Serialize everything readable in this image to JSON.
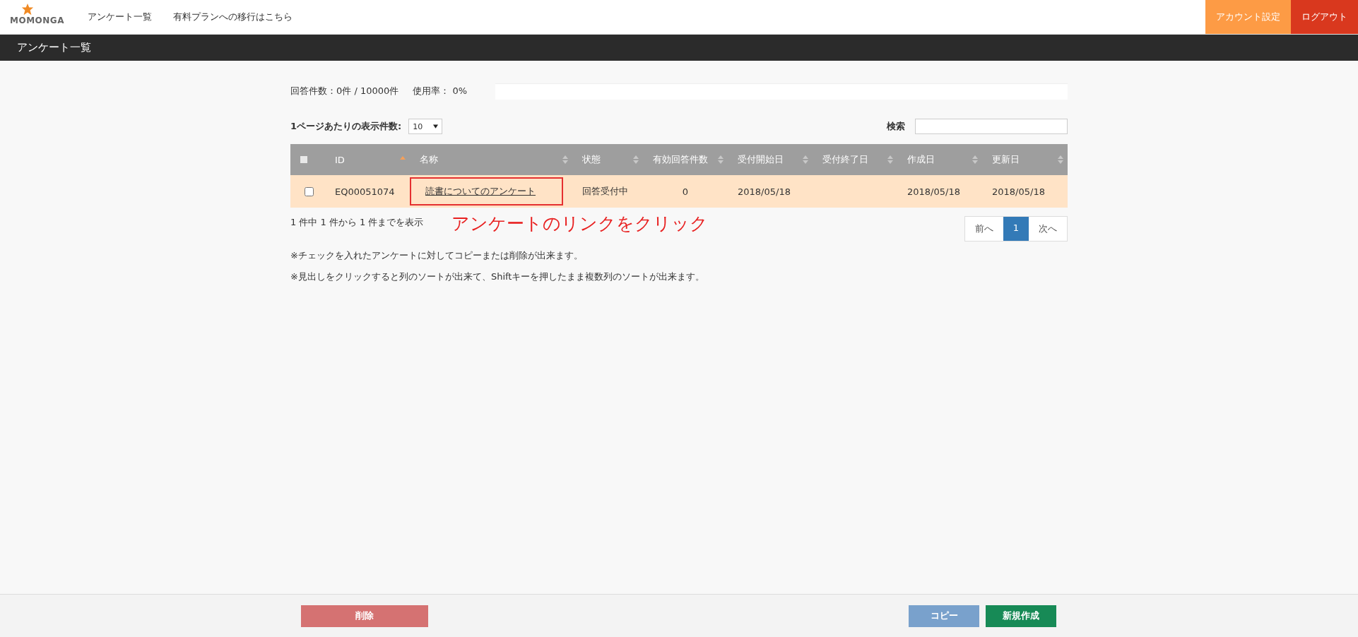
{
  "header": {
    "logo": "MOMONGA",
    "nav": [
      "アンケート一覧",
      "有料プランへの移行はこちら"
    ],
    "actions": [
      {
        "label": "アカウント設定",
        "kind": "account"
      },
      {
        "label": "ログアウト",
        "kind": "logout"
      }
    ]
  },
  "page_title": "アンケート一覧",
  "usage": {
    "count": "回答件数：0件 / 10000件",
    "rate": "使用率： 0%",
    "level": 0
  },
  "per_page": {
    "label": "1ページあたりの表示件数:",
    "value": "10"
  },
  "search": {
    "label": "検索"
  },
  "table": {
    "columns": [
      {
        "kind": "check",
        "checked": false
      },
      {
        "label": "ID",
        "kind": "text",
        "sortable": true,
        "sorted": true
      },
      {
        "label": "名称",
        "kind": "text",
        "sortable": true,
        "sorted": false
      },
      {
        "label": "状態",
        "kind": "text",
        "sortable": true,
        "sorted": false
      },
      {
        "label": "有効回答件数",
        "kind": "text",
        "sortable": true,
        "sorted": false
      },
      {
        "label": "受付開始日",
        "kind": "text",
        "sortable": true,
        "sorted": false
      },
      {
        "label": "受付終了日",
        "kind": "text",
        "sortable": true,
        "sorted": false
      },
      {
        "label": "作成日",
        "kind": "text",
        "sortable": true,
        "sorted": false
      },
      {
        "label": "更新日",
        "kind": "text",
        "sortable": true,
        "sorted": false
      }
    ],
    "rows": [
      {
        "checked": false,
        "id": "EQ00051074",
        "name": "読書についてのアンケート",
        "status": "回答受付中",
        "valid": "0",
        "start": "2018/05/18",
        "created": "2018/05/18",
        "updated": "2018/05/18"
      }
    ]
  },
  "info": "1 件中 1 件から 1 件までを表示",
  "annotation": "アンケートのリンクをクリック",
  "pagination": [
    {
      "label": "前へ",
      "selected": false
    },
    {
      "label": "1",
      "selected": true
    },
    {
      "label": "次へ",
      "selected": false
    }
  ],
  "notes": [
    "※チェックを入れたアンケートに対してコピーまたは削除が出来ます。",
    "※見出しをクリックすると列のソートが出来て、Shiftキーを押したまま複数列のソートが出来ます。"
  ],
  "footer": [
    {
      "label": "削除",
      "kind": "delete"
    },
    {
      "label": "コピー",
      "kind": "copy"
    },
    {
      "label": "新規作成",
      "kind": "create"
    }
  ]
}
